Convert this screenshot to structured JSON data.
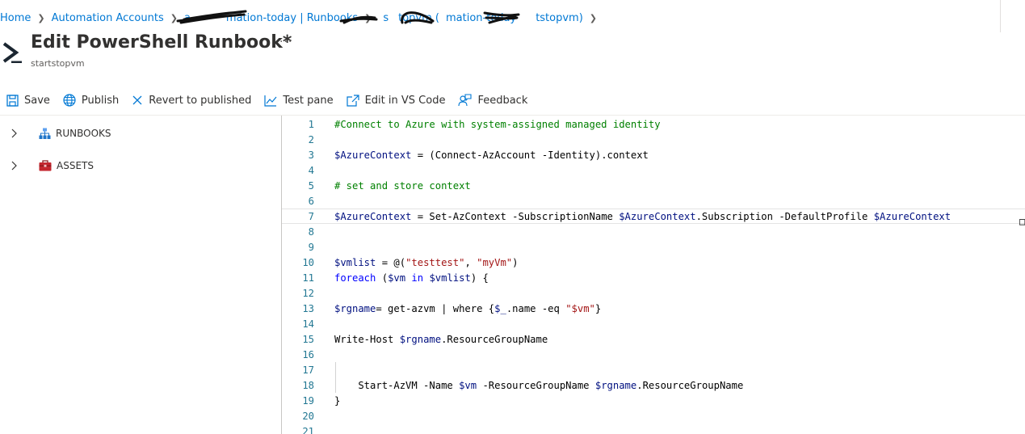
{
  "breadcrumb": {
    "home": "Home",
    "automation_accounts": "Automation Accounts",
    "runbooks_prefix": "a",
    "runbooks": "mation-today | Runbooks",
    "runbook_prefix": "s",
    "runbook": "topvm (",
    "runbook_mid": "mation-today",
    "runbook_suffix": "tstopvm)"
  },
  "header": {
    "title": "Edit PowerShell Runbook*",
    "subtitle": "startstopvm",
    "more": "···",
    "icon": "powershell-icon"
  },
  "toolbar": {
    "save": "Save",
    "publish": "Publish",
    "revert": "Revert to published",
    "test_pane": "Test pane",
    "edit_vscode": "Edit in VS Code",
    "feedback": "Feedback"
  },
  "tree": {
    "runbooks": "RUNBOOKS",
    "assets": "ASSETS"
  },
  "editor": {
    "line_numbers": [
      "1",
      "2",
      "3",
      "4",
      "5",
      "6",
      "7",
      "8",
      "9",
      "10",
      "11",
      "12",
      "13",
      "14",
      "15",
      "16",
      "17",
      "18",
      "19",
      "20",
      "21"
    ],
    "current_line": 7,
    "l1": "#Connect to Azure with system-assigned managed identity",
    "l3_var": "$AzureContext",
    "l3_rest": " = (Connect-AzAccount -Identity).context",
    "l5": "# set and store context",
    "l7_var1": "$AzureContext",
    "l7_a": " = Set-AzContext -SubscriptionName ",
    "l7_var2": "$AzureContext",
    "l7_b": ".Subscription -DefaultProfile ",
    "l7_var3": "$AzureContext",
    "l10_var": "$vmlist",
    "l10_a": " = @(",
    "l10_s1": "\"testtest\"",
    "l10_b": ", ",
    "l10_s2": "\"myVm\"",
    "l10_c": ")",
    "l11_kw1": "foreach",
    "l11_a": " (",
    "l11_var1": "$vm",
    "l11_kw2": " in ",
    "l11_var2": "$vmlist",
    "l11_b": ") {",
    "l13_var": "$rgname",
    "l13_a": "= get-azvm | where {",
    "l13_var2": "$_",
    "l13_b": ".name -eq ",
    "l13_str": "\"$vm\"",
    "l13_c": "}",
    "l15_a": "Write-Host ",
    "l15_var": "$rgname",
    "l15_b": ".ResourceGroupName",
    "l18_a": "    Start-AzVM -Name ",
    "l18_var1": "$vm",
    "l18_b": " -ResourceGroupName ",
    "l18_var2": "$rgname",
    "l18_c": ".ResourceGroupName",
    "l19": "}",
    "edge": "□"
  },
  "colors": {
    "link": "#0078d4",
    "comment": "#008000",
    "variable": "#001080",
    "string": "#a31515",
    "keyword": "#0000ff",
    "line_number": "#237893",
    "assets_icon": "#c4262e"
  }
}
